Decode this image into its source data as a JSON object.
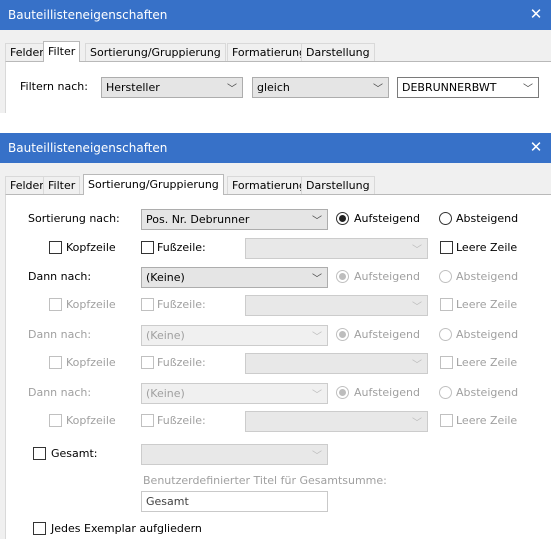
{
  "window1": {
    "title": "Bauteillisteneigenschaften",
    "tabs": [
      "Felder",
      "Filter",
      "Sortierung/Gruppierung",
      "Formatierung",
      "Darstellung"
    ],
    "active_tab": "Filter",
    "filter_label": "Filtern nach:",
    "field_value": "Hersteller",
    "operator_value": "gleich",
    "filter_value": "DEBRUNNERBWT"
  },
  "window2": {
    "title": "Bauteillisteneigenschaften",
    "tabs": [
      "Felder",
      "Filter",
      "Sortierung/Gruppierung",
      "Formatierung",
      "Darstellung"
    ],
    "active_tab": "Sortierung/Gruppierung",
    "sort_label": "Sortierung nach:",
    "sort_value": "Pos. Nr. Debrunner",
    "then_label_1": "Dann nach:",
    "then_label_2": "Dann nach:",
    "then_label_3": "Dann nach:",
    "none_value": "(Keine)",
    "ascending": "Aufsteigend",
    "descending": "Absteigend",
    "header": "Kopfzeile",
    "footer": "Fußzeile:",
    "blank_line": "Leere Zeile",
    "grand_total": "Gesamt:",
    "custom_total_title_placeholder": "Benutzerdefinierter Titel für Gesamtsumme:",
    "custom_total_title_value": "Gesamt",
    "itemize_label": "Jedes Exemplar aufgliedern"
  },
  "icons": {
    "close": "close-icon",
    "dropdown": "chevron-down-icon"
  },
  "colors": {
    "titlebar": "#3771c8",
    "dialog": "#f0f0f0",
    "panel": "#ffffff"
  }
}
